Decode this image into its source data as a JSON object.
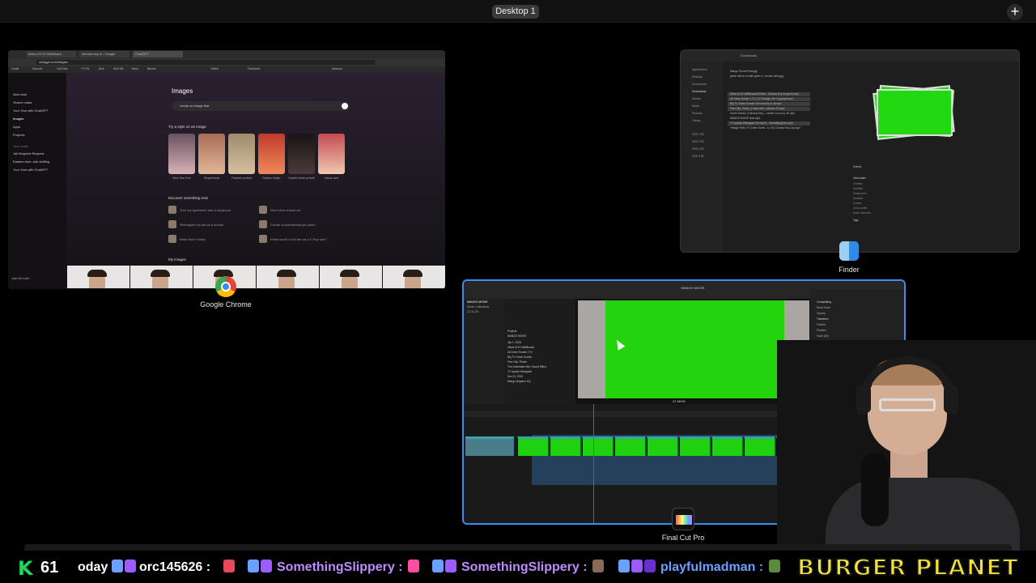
{
  "top_bar": {
    "desktop_label": "Desktop 1",
    "add_label": "+"
  },
  "chrome": {
    "app_label": "Google Chrome",
    "tabs": [
      "#New #YCH #Billboard",
      "chrome key in - Google",
      "ChatGPT"
    ],
    "url": "chatgpt.com/images",
    "bookmarks": [
      "Gmail",
      "Discord",
      "YouTube",
      "YT+GL",
      "Kick",
      "Kick DB",
      "Tesco",
      "Bitcoin",
      "Twitch",
      "Facebook",
      "Amazon"
    ],
    "sidebar": {
      "items": [
        "New chat",
        "Search chats",
        "Your Year with ChatGPT",
        "Images",
        "Apps",
        "Projects"
      ],
      "section": "Your chats",
      "chats": [
        "Jail Mugshot Request",
        "Eastern riser, dub shifting",
        "Your Year with ChatGPT"
      ],
      "user": "Josh McCutch..."
    },
    "main": {
      "title": "Images",
      "input_text": "create an image that",
      "try_style": "Try a style on an image",
      "styles": [
        "New Year Eve",
        "Gingerbread",
        "Parisian portrait",
        "Santa's helper",
        "Scarlet metal portrait",
        "Candy land"
      ],
      "discover": "Discover something new",
      "discover_items": [
        "Turn my apartment into a storybook",
        "Give them a bowl cut",
        "Reimagine my pet as a human",
        "Create a professional job photo",
        "Make them Santa",
        "What would I look like as a K-Pop star?"
      ],
      "my_images": "My images"
    }
  },
  "finder": {
    "app_label": "Finder",
    "title": "Downloads",
    "sidebar": [
      "Applications",
      "Desktop",
      "Documents",
      "Downloads",
      "Movies",
      "Music",
      "Pictures",
      "Library",
      "SSD 1TB",
      "SSD 2TB",
      "SSD 4TB",
      "SSD 8TB"
    ],
    "files": [
      "Mango Thumb Final.jpg",
      "green suit on vs with green s...hroma video.jpg",
      "#New #YCH #Billboard #Green...Chroma Key #s green.mp4",
      "4k Green Screen | TV | Tv Footage | No Copyright.mp4",
      "Big TV Green Screen Chroma Key in 4k.mp4",
      "Free Clip: Finder | | hand with...screens TV.mp4",
      "Green Screen | Chroma Key | ...screen in room | 4K.mp4",
      "MANGO MOVIE final.mp4",
      "TV Upside Windgade Chroma K...Incredibly green.mp4",
      "Vintage Retro TV Green Scree...s | HD Chroma Key Clip.mp4"
    ],
    "info": {
      "count": "5 items",
      "heading": "Information",
      "rows": [
        "Created",
        "Modified",
        "Dimensions",
        "Duration",
        "Codecs",
        "Color profile",
        "Audio channels"
      ],
      "tags": "Tags"
    }
  },
  "fcp": {
    "app_label": "Final Cut Pro",
    "libraries": [
      "MANGO MOVIE",
      "Smart Collections",
      "12-31-25"
    ],
    "browser": [
      "Jan 1, 2026",
      "Dec 31, 2025",
      "Projects",
      "MANGO MOVIE"
    ],
    "clips": [
      "#New #YCH #Billboard",
      "4k Green Screen | TV",
      "Big TV Green Screen",
      "Free Clip: Finder",
      "The Undertaker Bat: Sound Effect",
      "TV Upside Windgade",
      "Mango Mugshot HQ"
    ],
    "viewer_title": "MANGO MOVIE",
    "timecode": "37:48:06",
    "inspector": [
      "Compositing",
      "Blend Mode",
      "Opacity",
      "Transform",
      "Position",
      "Rotation",
      "Scale (All)",
      "Scale X",
      "Scale Y",
      "Anchor",
      "Crop",
      "Type",
      "Left",
      "Right",
      "Top",
      "Bottom",
      "Distort"
    ],
    "timeline_title": "MANGO MOVIE"
  },
  "ticker": {
    "k_icon": "K",
    "count": "61",
    "items": [
      {
        "name": "oday",
        "color": "#ffffff"
      },
      {
        "name": "orc145626 :",
        "color": "#ffffff"
      },
      {
        "name": "SomethingSlippery :",
        "color": "#c08bff"
      },
      {
        "name": "SomethingSlippery :",
        "color": "#c08bff"
      },
      {
        "name": "playfulmadman :",
        "color": "#6aa0ff"
      }
    ],
    "banner": "BURGER PLANET"
  }
}
